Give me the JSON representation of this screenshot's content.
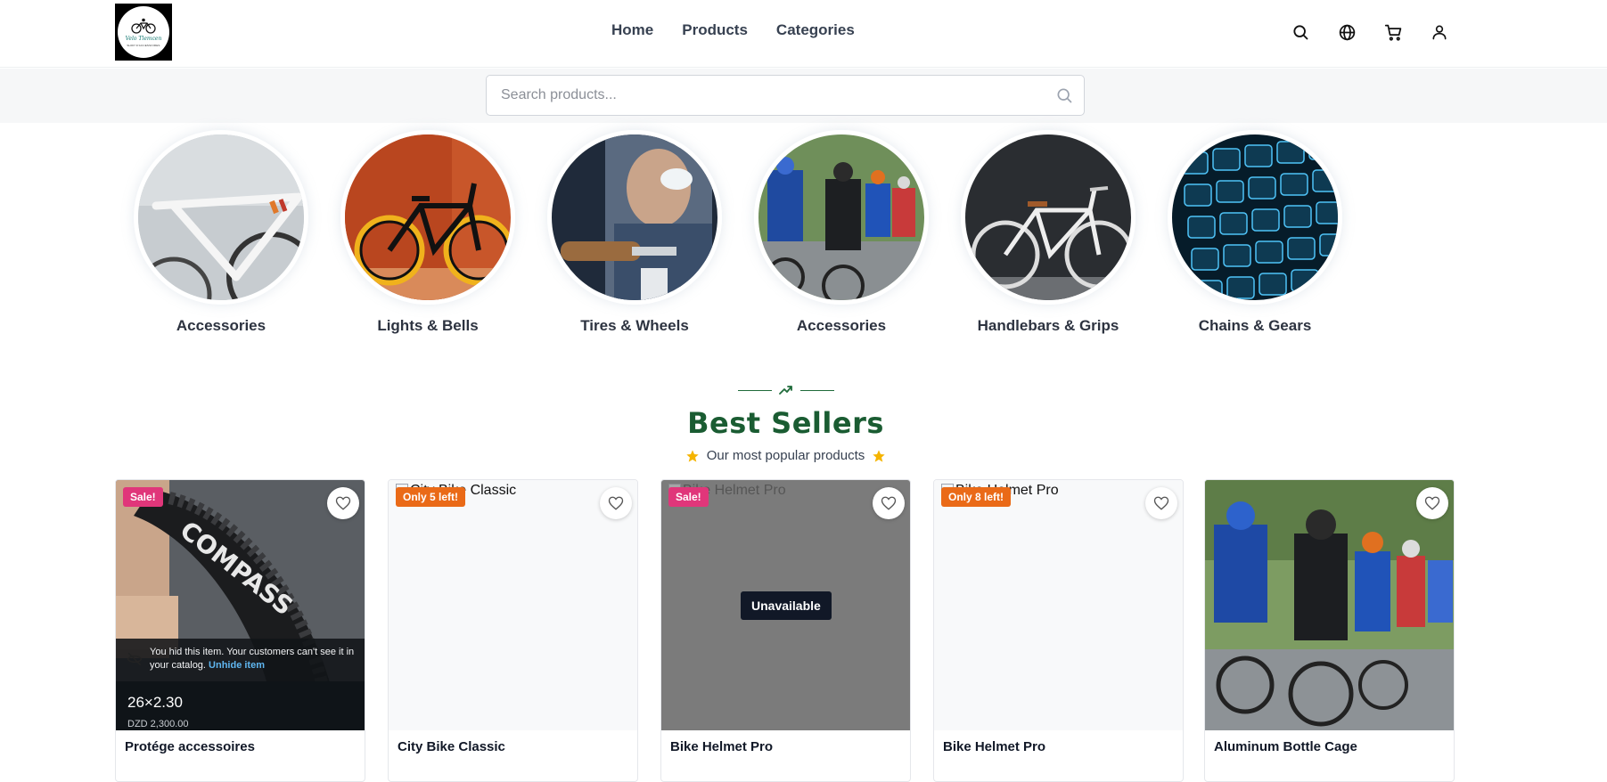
{
  "header": {
    "logo": {
      "text": "Velo Tlemcen",
      "subtext": "SHOP D'ACCESSOIRES"
    },
    "nav": [
      {
        "label": "Home"
      },
      {
        "label": "Products"
      },
      {
        "label": "Categories"
      }
    ],
    "icons": [
      "search-icon",
      "globe-icon",
      "cart-icon",
      "user-icon"
    ]
  },
  "search": {
    "placeholder": "Search products..."
  },
  "categories": [
    {
      "label": "Accessories"
    },
    {
      "label": "Lights & Bells"
    },
    {
      "label": "Tires & Wheels"
    },
    {
      "label": "Accessories"
    },
    {
      "label": "Handlebars & Grips"
    },
    {
      "label": "Chains & Gears"
    }
  ],
  "best_sellers": {
    "title": "Best Sellers",
    "subtitle": "Our most popular products",
    "products": [
      {
        "name": "Protége accessoires",
        "badge": "Sale!",
        "badge_type": "sale",
        "hidden_note": "You hid this item. Your customers can't see it in your catalog.",
        "unhide_label": "Unhide item",
        "overlay_title": "26×2.30",
        "overlay_price": "DZD 2,300.00"
      },
      {
        "name": "City Bike Classic",
        "badge": "Only 5 left!",
        "badge_type": "stock",
        "alt": "City Bike Classic"
      },
      {
        "name": "Bike Helmet Pro",
        "badge": "Sale!",
        "badge_type": "sale",
        "alt": "Bike Helmet Pro",
        "status": "Unavailable"
      },
      {
        "name": "Bike Helmet Pro",
        "badge": "Only 8 left!",
        "badge_type": "stock",
        "alt": "Bike Helmet Pro"
      },
      {
        "name": "Aluminum Bottle Cage"
      }
    ]
  },
  "colors": {
    "title_green": "#1a5c32",
    "sale_pink": "#e0367a",
    "stock_orange": "#ea6a17",
    "unhide_blue": "#5fb6f0"
  }
}
